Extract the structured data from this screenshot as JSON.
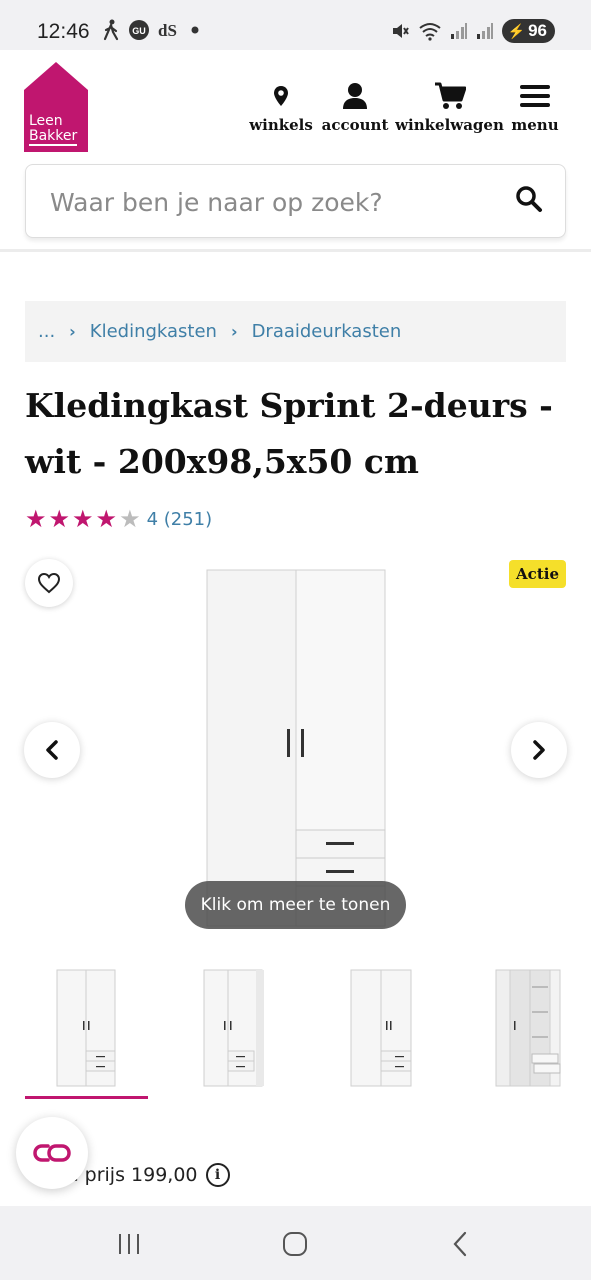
{
  "status_bar": {
    "time": "12:46",
    "left_icons": [
      "walking-icon",
      "gu-icon",
      "ds-icon",
      "dot-icon"
    ],
    "right_icons": [
      "mute-icon",
      "wifi-icon",
      "signal-icon",
      "signal-icon"
    ],
    "battery": "96"
  },
  "header": {
    "logo_line1": "Leen",
    "logo_line2": "Bakker",
    "brand_color": "#c0166f",
    "nav": [
      {
        "label": "winkels",
        "icon": "location-pin-icon"
      },
      {
        "label": "account",
        "icon": "user-icon"
      },
      {
        "label": "winkelwagen",
        "icon": "cart-icon"
      },
      {
        "label": "menu",
        "icon": "hamburger-icon"
      }
    ],
    "search_placeholder": "Waar ben je naar op zoek?"
  },
  "breadcrumb": {
    "ellipsis": "...",
    "items": [
      "Kledingkasten",
      "Draaideurkasten"
    ]
  },
  "product": {
    "title": "Kledingkast Sprint 2-deurs - wit - 200x98,5x50 cm",
    "rating": 4,
    "rating_max": 5,
    "rating_text": "4 (251)",
    "badge": "Actie",
    "gallery_hint": "Klik om meer te tonen",
    "thumbnail_count": 4,
    "active_thumbnail": 1,
    "price_text": "ale prijs 199,00",
    "badge_color": "#f5df2a"
  },
  "system_nav": [
    "recent-apps-icon",
    "home-icon",
    "back-icon"
  ]
}
